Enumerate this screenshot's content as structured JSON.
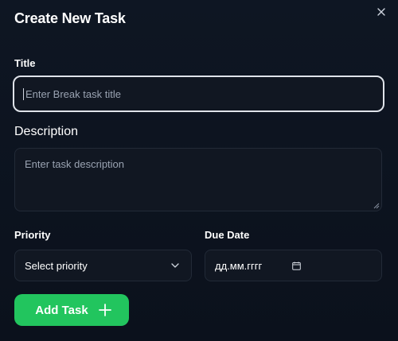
{
  "dialog": {
    "title": "Create New Task",
    "close_icon": "close-icon"
  },
  "form": {
    "title_label": "Title",
    "title_placeholder": "Enter Break task title",
    "description_label": "Description",
    "description_placeholder": "Enter task description",
    "priority_label": "Priority",
    "priority_value": "Select priority",
    "due_date_label": "Due Date",
    "due_date_value": "дд.мм.гггг",
    "submit_label": "Add Task"
  },
  "icons": {
    "close": "close-icon",
    "chevron": "chevron-down-icon",
    "calendar": "calendar-icon",
    "plus": "plus-icon",
    "resize": "resize-handle-icon"
  },
  "colors": {
    "background": "#0b111c",
    "input_bg": "#111722",
    "accent_green": "#22c55e",
    "text": "#ffffff"
  }
}
